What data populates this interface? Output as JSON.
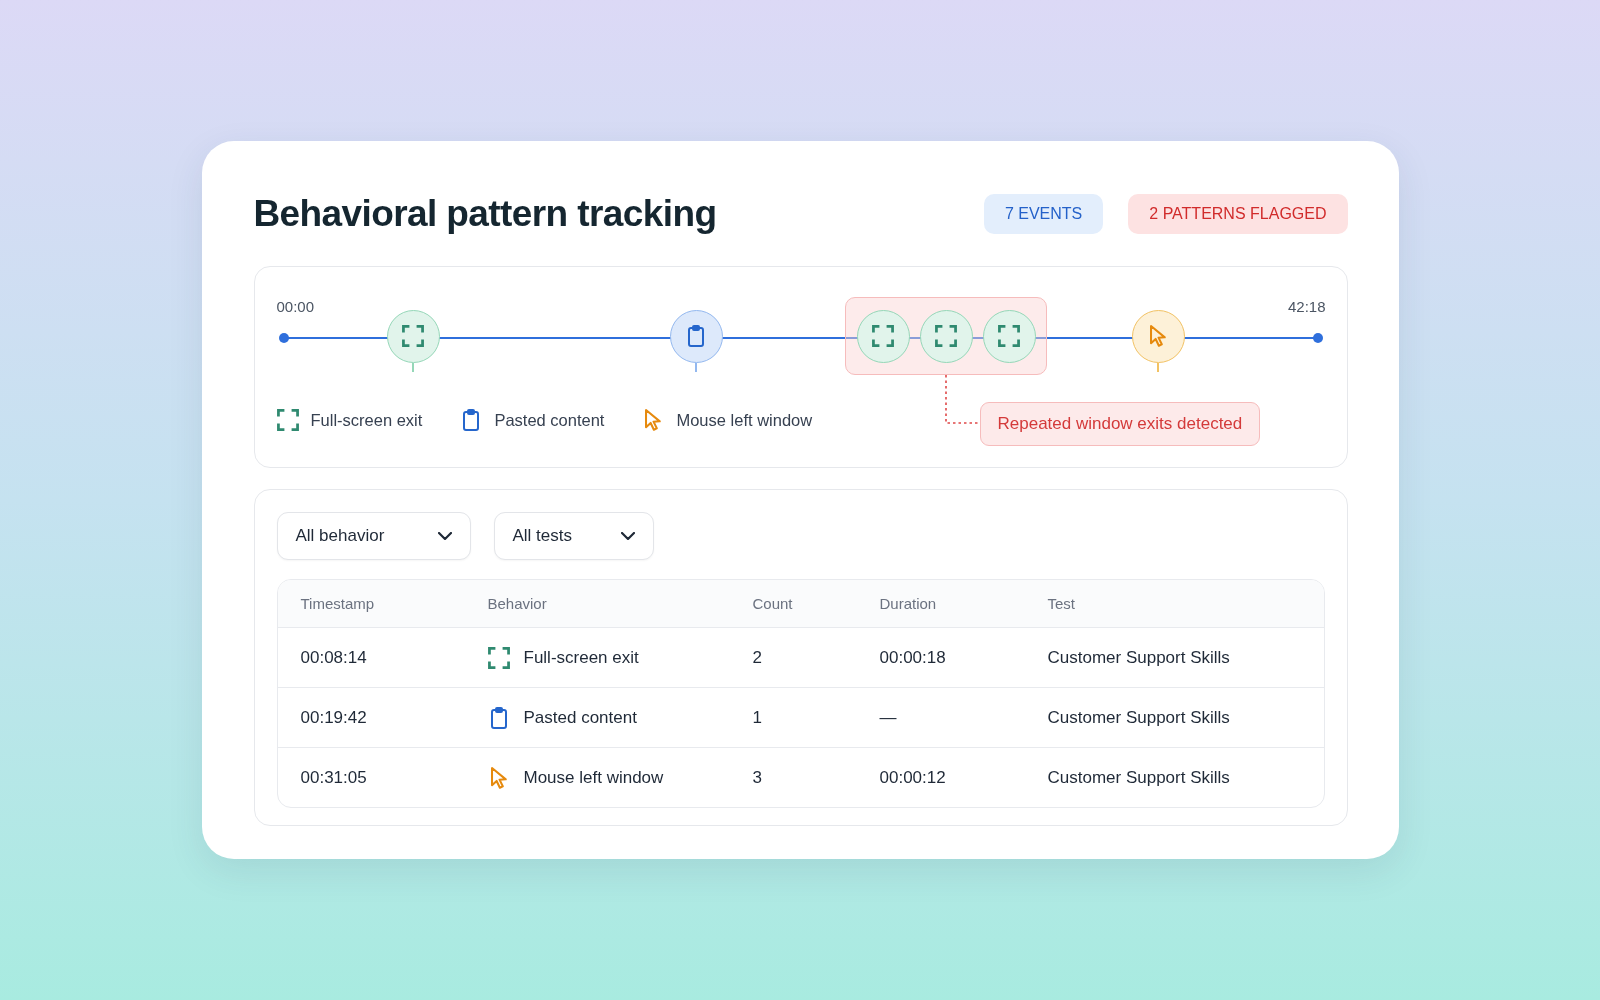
{
  "title": "Behavioral pattern tracking",
  "badges": [
    {
      "kind": "info",
      "label": "7 EVENTS"
    },
    {
      "kind": "alert",
      "label": "2 PATTERNS FLAGGED"
    }
  ],
  "timeline": {
    "start_label": "00:00",
    "end_label": "42:18",
    "items": [
      {
        "kind": "fullscreen"
      },
      {
        "kind": "paste"
      },
      {
        "kind": "group",
        "events": [
          {
            "kind": "fullscreen"
          },
          {
            "kind": "fullscreen"
          },
          {
            "kind": "fullscreen"
          }
        ],
        "callout": "Repeated window exits detected"
      },
      {
        "kind": "mouse"
      }
    ],
    "legend": [
      {
        "kind": "fullscreen",
        "label": "Full-screen exit"
      },
      {
        "kind": "paste",
        "label": "Pasted content"
      },
      {
        "kind": "mouse",
        "label": "Mouse left window"
      }
    ]
  },
  "filters": [
    {
      "value": "All behavior"
    },
    {
      "value": "All tests"
    }
  ],
  "table": {
    "columns": [
      "Timestamp",
      "Behavior",
      "Count",
      "Duration",
      "Test"
    ],
    "rows": [
      {
        "timestamp": "00:08:14",
        "behavior": {
          "kind": "fullscreen",
          "label": "Full-screen exit"
        },
        "count": "2",
        "duration": "00:00:18",
        "test": "Customer Support Skills"
      },
      {
        "timestamp": "00:19:42",
        "behavior": {
          "kind": "paste",
          "label": "Pasted content"
        },
        "count": "1",
        "duration": "—",
        "test": "Customer Support Skills"
      },
      {
        "timestamp": "00:31:05",
        "behavior": {
          "kind": "mouse",
          "label": "Mouse left window"
        },
        "count": "3",
        "duration": "00:00:12",
        "test": "Customer Support Skills"
      }
    ]
  }
}
